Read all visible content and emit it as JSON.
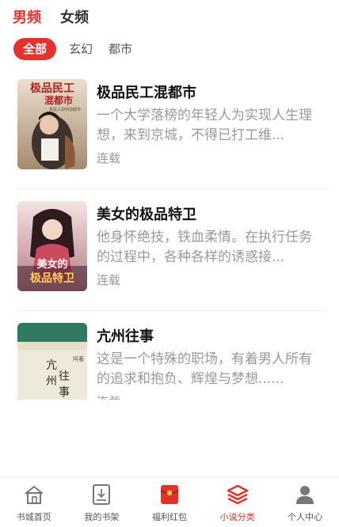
{
  "gender_tabs": [
    {
      "label": "男频",
      "active": true
    },
    {
      "label": "女频",
      "active": false
    }
  ],
  "category_tabs": [
    {
      "label": "全部",
      "active": true
    },
    {
      "label": "玄幻",
      "active": false
    },
    {
      "label": "都市",
      "active": false
    }
  ],
  "books": [
    {
      "title": "极品民工混都市",
      "description": "一个大学落榜的年轻人为实现人生理想，来到京城，不得已打工维...",
      "status": "连载",
      "cover_text": "极品民工混都市",
      "cover_subtext": "看民工如何混都市",
      "cover_colors": [
        "#c9b49a",
        "#6e4b3a"
      ]
    },
    {
      "title": "美女的极品特卫",
      "description": "他身怀绝技，铁血柔情。在执行任务的过程中，各种各样的诱惑接...",
      "status": "连载",
      "cover_text": "美女的极品特卫",
      "cover_colors": [
        "#e7d0cf",
        "#5a2431"
      ]
    },
    {
      "title": "亢州往事",
      "description": "这是一个特殊的职场，有着男人所有的追求和抱负、辉煌与梦想......",
      "status": "连载",
      "cover_text": "亢州往事",
      "cover_author": "阿著",
      "cover_colors": [
        "#efe8d8",
        "#2d7d63"
      ]
    }
  ],
  "tabbar": [
    {
      "label": "书城首页",
      "icon": "home-icon",
      "active": false
    },
    {
      "label": "我的书架",
      "icon": "bookshelf-icon",
      "active": false
    },
    {
      "label": "福利红包",
      "icon": "red-envelope-icon",
      "active": false
    },
    {
      "label": "小说分类",
      "icon": "category-layers-icon",
      "active": true
    },
    {
      "label": "个人中心",
      "icon": "user-icon",
      "active": false
    }
  ],
  "colors": {
    "accent": "#e5322d",
    "text_secondary": "#999999"
  }
}
